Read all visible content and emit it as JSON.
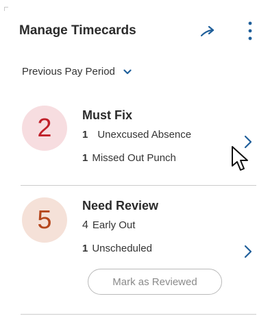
{
  "header": {
    "title": "Manage Timecards",
    "share_icon": "share-arrow-icon",
    "more_icon": "kebab-menu-icon"
  },
  "period_selector": {
    "label": "Previous Pay Period",
    "icon": "chevron-down-icon"
  },
  "cards": [
    {
      "count": "2",
      "title": "Must Fix",
      "exceptions": [
        {
          "count": "1",
          "label": "Unexcused Absence"
        },
        {
          "count": "1",
          "label": "Missed Out Punch"
        }
      ],
      "badge_bg": "#f7dde0",
      "badge_color": "#c0202a"
    },
    {
      "count": "5",
      "title": "Need Review",
      "exceptions": [
        {
          "count": "4",
          "label": "Early Out"
        },
        {
          "count": "1",
          "label": "Unscheduled"
        }
      ],
      "action_label": "Mark as Reviewed",
      "badge_bg": "#f5e1d8",
      "badge_color": "#b5461c"
    }
  ],
  "colors": {
    "accent": "#1f5f9a",
    "text": "#2b2b2b",
    "divider": "#cccccc"
  }
}
